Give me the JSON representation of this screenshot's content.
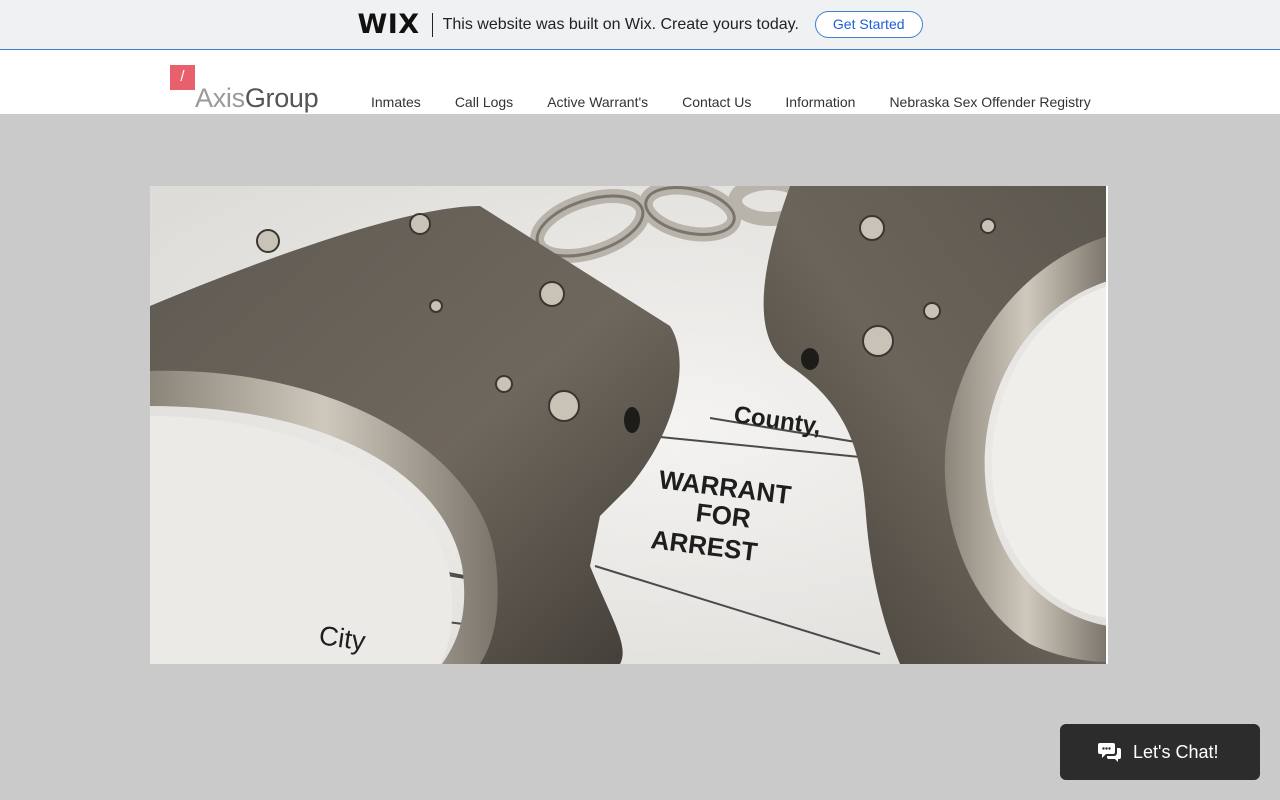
{
  "wix_banner": {
    "logo": "WIX",
    "message": "This website was built on Wix. Create yours today.",
    "cta": "Get Started"
  },
  "site": {
    "logo_badge": "/",
    "logo_part1": "Axis",
    "logo_part2": "Group"
  },
  "nav": {
    "items": [
      "Inmates",
      "Call Logs",
      "Active Warrant's",
      "Contact Us",
      "Information",
      "Nebraska Sex Offender Registry"
    ]
  },
  "hero": {
    "doc_county": "County,",
    "doc_title_1": "WARRANT",
    "doc_title_2": "FOR",
    "doc_title_3": "ARREST",
    "doc_city": "City"
  },
  "chat": {
    "label": "Let's Chat!"
  },
  "colors": {
    "background": "#cacaca",
    "badge": "#e8606b",
    "accent": "#3f7fd6",
    "chat_bg": "#2c2c2c"
  }
}
